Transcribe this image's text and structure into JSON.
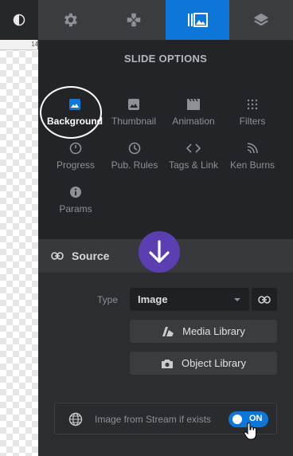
{
  "canvas": {
    "ruler_number": "14"
  },
  "tabs": [
    {
      "icon": "gear-icon",
      "active": false
    },
    {
      "icon": "gamepad-icon",
      "active": false
    },
    {
      "icon": "slide-options-icon",
      "active": true
    },
    {
      "icon": "layers-icon",
      "active": false
    }
  ],
  "options": {
    "title": "SLIDE OPTIONS",
    "items": [
      {
        "label": "Background",
        "icon": "image-icon",
        "active": true
      },
      {
        "label": "Thumbnail",
        "icon": "thumbnail-icon"
      },
      {
        "label": "Animation",
        "icon": "film-icon"
      },
      {
        "label": "Filters",
        "icon": "filters-icon"
      },
      {
        "label": "Progress",
        "icon": "clock-icon"
      },
      {
        "label": "Pub. Rules",
        "icon": "clock-icon"
      },
      {
        "label": "Tags & Link",
        "icon": "code-icon"
      },
      {
        "label": "Ken Burns",
        "icon": "kenburns-icon"
      },
      {
        "label": "Params",
        "icon": "info-icon"
      }
    ]
  },
  "source": {
    "header": "Source",
    "type_label": "Type",
    "type_value": "Image",
    "media_library": "Media Library",
    "object_library": "Object Library",
    "stream_label": "Image from Stream if exists",
    "stream_toggle": "ON"
  },
  "colors": {
    "accent": "#0f76d9",
    "badge": "#5b3fb0"
  }
}
